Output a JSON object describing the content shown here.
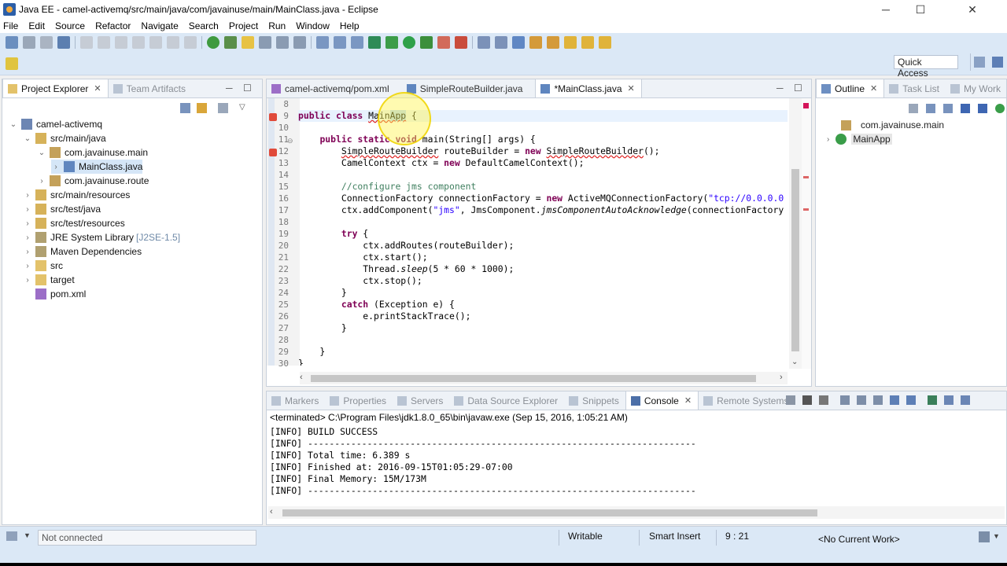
{
  "window": {
    "title": "Java EE - camel-activemq/src/main/java/com/javainuse/main/MainClass.java - Eclipse",
    "controls": {
      "minimize": "─",
      "maximize": "☐",
      "close": "✕"
    }
  },
  "menu": [
    "File",
    "Edit",
    "Source",
    "Refactor",
    "Navigate",
    "Search",
    "Project",
    "Run",
    "Window",
    "Help"
  ],
  "toolbar": {
    "quick_access_placeholder": "Quick Access"
  },
  "project_explorer": {
    "tabs": [
      "Project Explorer",
      "Team Artifacts"
    ],
    "tree": [
      {
        "label": "camel-activemq",
        "depth": 0,
        "arrow": "⌄",
        "icon": "project-icon"
      },
      {
        "label": "src/main/java",
        "depth": 1,
        "arrow": "⌄",
        "icon": "source-folder-icon"
      },
      {
        "label": "com.javainuse.main",
        "depth": 2,
        "arrow": "⌄",
        "icon": "package-icon"
      },
      {
        "label": "MainClass.java",
        "depth": 3,
        "arrow": "›",
        "icon": "java-file-icon",
        "selected": true
      },
      {
        "label": "com.javainuse.route",
        "depth": 2,
        "arrow": "›",
        "icon": "package-icon"
      },
      {
        "label": "src/main/resources",
        "depth": 1,
        "arrow": "›",
        "icon": "source-folder-icon"
      },
      {
        "label": "src/test/java",
        "depth": 1,
        "arrow": "›",
        "icon": "source-folder-icon"
      },
      {
        "label": "src/test/resources",
        "depth": 1,
        "arrow": "›",
        "icon": "source-folder-icon"
      },
      {
        "label": "JRE System Library",
        "decoration": "[J2SE-1.5]",
        "depth": 1,
        "arrow": "›",
        "icon": "library-icon"
      },
      {
        "label": "Maven Dependencies",
        "depth": 1,
        "arrow": "›",
        "icon": "library-icon"
      },
      {
        "label": "src",
        "depth": 1,
        "arrow": "›",
        "icon": "folder-icon"
      },
      {
        "label": "target",
        "depth": 1,
        "arrow": "›",
        "icon": "folder-icon"
      },
      {
        "label": "pom.xml",
        "depth": 1,
        "arrow": "",
        "icon": "xml-file-icon"
      }
    ]
  },
  "editor": {
    "tabs": [
      "camel-activemq/pom.xml",
      "SimpleRouteBuilder.java",
      "*MainClass.java"
    ],
    "line_numbers": [
      "8",
      "9",
      "10",
      "11",
      "12",
      "13",
      "14",
      "15",
      "16",
      "17",
      "18",
      "19",
      "20",
      "21",
      "22",
      "23",
      "24",
      "25",
      "26",
      "27",
      "28",
      "29",
      "30"
    ],
    "code": {
      "l8": "",
      "l9_kw": "public class ",
      "l9_name_a": "Main",
      "l9_name_b": "App",
      "l9_rest": " {",
      "l11_indent": "    ",
      "l11_kw": "public static void ",
      "l11_rest": "main(String[] args) {",
      "l12_indent": "        ",
      "l12_err": "SimpleRouteBuilder",
      "l12_rest_a": " routeBuilder = ",
      "l12_kw": "new ",
      "l12_err2": "SimpleRouteBuilder",
      "l12_rest_b": "();",
      "l13": "        CamelContext ctx = ",
      "l13_kw": "new ",
      "l13_rest": "DefaultCamelContext();",
      "l15": "        //configure jms component",
      "l16_a": "        ConnectionFactory connectionFactory = ",
      "l16_kw": "new ",
      "l16_b": "ActiveMQConnectionFactory(",
      "l16_str": "\"tcp://0.0.0.0",
      "l17_a": "        ctx.addComponent(",
      "l17_str": "\"jms\"",
      "l17_b": ", JmsComponent.",
      "l17_it": "jmsComponentAutoAcknowledge",
      "l17_c": "(connectionFactory",
      "l19_kw": "        try ",
      "l19_rest": "{",
      "l20": "            ctx.addRoutes(routeBuilder);",
      "l21": "            ctx.start();",
      "l22_a": "            Thread.",
      "l22_it": "sleep",
      "l22_b": "(5 * 60 * 1000);",
      "l23": "            ctx.stop();",
      "l24": "        }",
      "l25_kw": "        catch ",
      "l25_rest": "(Exception e) {",
      "l26": "            e.printStackTrace();",
      "l27": "        }",
      "l29": "    }",
      "l30": "}"
    }
  },
  "outline": {
    "tabs": [
      "Outline",
      "Task List",
      "My Work"
    ],
    "items": [
      {
        "label": "com.javainuse.main",
        "icon": "package-icon"
      },
      {
        "label": "MainApp",
        "icon": "class-icon"
      }
    ]
  },
  "console": {
    "tabs": [
      "Markers",
      "Properties",
      "Servers",
      "Data Source Explorer",
      "Snippets",
      "Console",
      "Remote Systems"
    ],
    "header": "<terminated> C:\\Program Files\\jdk1.8.0_65\\bin\\javaw.exe (Sep 15, 2016, 1:05:21 AM)",
    "lines": [
      "[INFO] BUILD SUCCESS",
      "[INFO] ------------------------------------------------------------------------",
      "[INFO] Total time: 6.389 s",
      "[INFO] Finished at: 2016-09-15T01:05:29-07:00",
      "[INFO] Final Memory: 15M/173M",
      "[INFO] ------------------------------------------------------------------------"
    ]
  },
  "status": {
    "connection": "Not connected",
    "writable": "Writable",
    "insert_mode": "Smart Insert",
    "position": "9 : 21",
    "context": "<No Current Work>"
  },
  "colors": {
    "keyword": "#7f0055",
    "comment": "#3f7f5f",
    "string": "#2a00ff",
    "selection": "#b3d7ff",
    "toolbar_bg": "#dbe8f6"
  }
}
